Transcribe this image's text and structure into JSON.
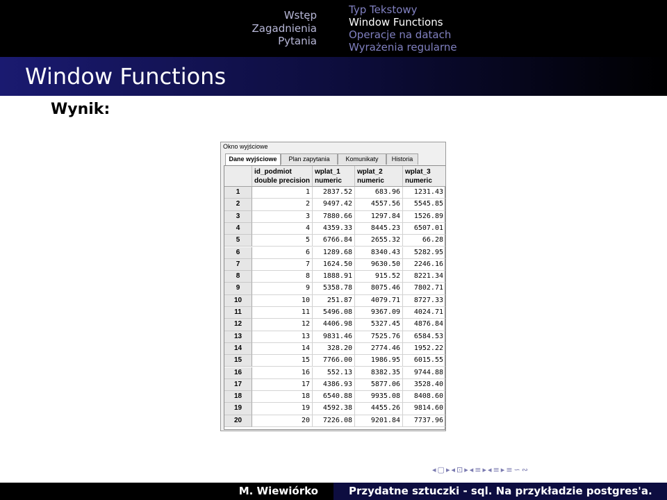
{
  "header": {
    "sections": [
      "Wstęp",
      "Zagadnienia",
      "Pytania"
    ],
    "subsections": [
      "Typ Tekstowy",
      "Window Functions",
      "Operacje na datach",
      "Wyrażenia regularne"
    ],
    "current_subsection": "Window Functions"
  },
  "frame_title": "Window Functions",
  "result_label": "Wynik:",
  "window": {
    "title": "Okno wyjściowe",
    "tabs": [
      "Dane wyjściowe",
      "Plan zapytania",
      "Komunikaty",
      "Historia"
    ],
    "active_tab": "Dane wyjściowe",
    "columns": [
      {
        "name": "id_podmiot",
        "type": "double precision"
      },
      {
        "name": "wplat_1",
        "type": "numeric"
      },
      {
        "name": "wplat_2",
        "type": "numeric"
      },
      {
        "name": "wplat_3",
        "type": "numeric"
      }
    ],
    "rows": [
      [
        "1",
        "1",
        "2837.52",
        "683.96",
        "1231.43"
      ],
      [
        "2",
        "2",
        "9497.42",
        "4557.56",
        "5545.85"
      ],
      [
        "3",
        "3",
        "7880.66",
        "1297.84",
        "1526.89"
      ],
      [
        "4",
        "4",
        "4359.33",
        "8445.23",
        "6507.01"
      ],
      [
        "5",
        "5",
        "6766.84",
        "2655.32",
        "66.28"
      ],
      [
        "6",
        "6",
        "1289.68",
        "8340.43",
        "5282.95"
      ],
      [
        "7",
        "7",
        "1624.50",
        "9630.50",
        "2246.16"
      ],
      [
        "8",
        "8",
        "1888.91",
        "915.52",
        "8221.34"
      ],
      [
        "9",
        "9",
        "5358.78",
        "8075.46",
        "7802.71"
      ],
      [
        "10",
        "10",
        "251.87",
        "4079.71",
        "8727.33"
      ],
      [
        "11",
        "11",
        "5496.08",
        "9367.09",
        "4024.71"
      ],
      [
        "12",
        "12",
        "4406.98",
        "5327.45",
        "4876.84"
      ],
      [
        "13",
        "13",
        "9831.46",
        "7525.76",
        "6584.53"
      ],
      [
        "14",
        "14",
        "328.20",
        "2774.46",
        "1952.22"
      ],
      [
        "15",
        "15",
        "7766.00",
        "1986.95",
        "6015.55"
      ],
      [
        "16",
        "16",
        "552.13",
        "8382.35",
        "9744.88"
      ],
      [
        "17",
        "17",
        "4386.93",
        "5877.06",
        "3528.40"
      ],
      [
        "18",
        "18",
        "6540.88",
        "9935.08",
        "8408.60"
      ],
      [
        "19",
        "19",
        "4592.38",
        "4455.26",
        "9814.60"
      ],
      [
        "20",
        "20",
        "7226.08",
        "9201.84",
        "7737.96"
      ]
    ]
  },
  "nav_icons": [
    "◂",
    "▢",
    "▸",
    "◂",
    "⊡",
    "▸",
    "◂",
    "≡",
    "▸",
    "◂",
    "≡",
    "▸",
    "≡",
    "∽",
    "∾"
  ],
  "footer": {
    "author": "M. Wiewiórko",
    "talk_title": "Przydatne sztuczki - sql. Na przykładzie postgres'a."
  }
}
